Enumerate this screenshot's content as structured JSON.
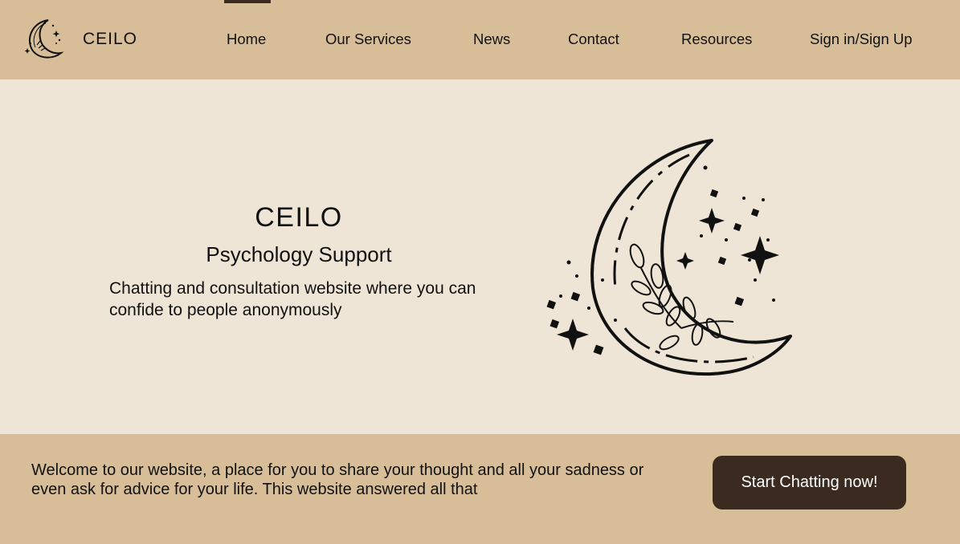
{
  "brand": {
    "name": "CEILO",
    "logo_icon": "crescent-moon-logo-icon"
  },
  "nav": {
    "items": [
      {
        "label": "Home",
        "active": true
      },
      {
        "label": "Our Services"
      },
      {
        "label": "News"
      },
      {
        "label": "Contact"
      },
      {
        "label": "Resources"
      },
      {
        "label": "Sign in/Sign Up"
      }
    ]
  },
  "hero": {
    "title": "CEILO",
    "subtitle": "Psychology Support",
    "description": "Chatting and consultation website where you can confide to people anonymously",
    "illustration": "crescent-moon-stars-illustration"
  },
  "welcome": {
    "text": "Welcome to our website, a place for you to share your thought and all your sadness or even ask for advice for your life. This website answered all that",
    "cta_label": "Start Chatting now!"
  },
  "colors": {
    "nav_bg": "#d7be99",
    "hero_bg": "#efe5d6",
    "accent_dark": "#3a2a20",
    "text": "#111111"
  }
}
